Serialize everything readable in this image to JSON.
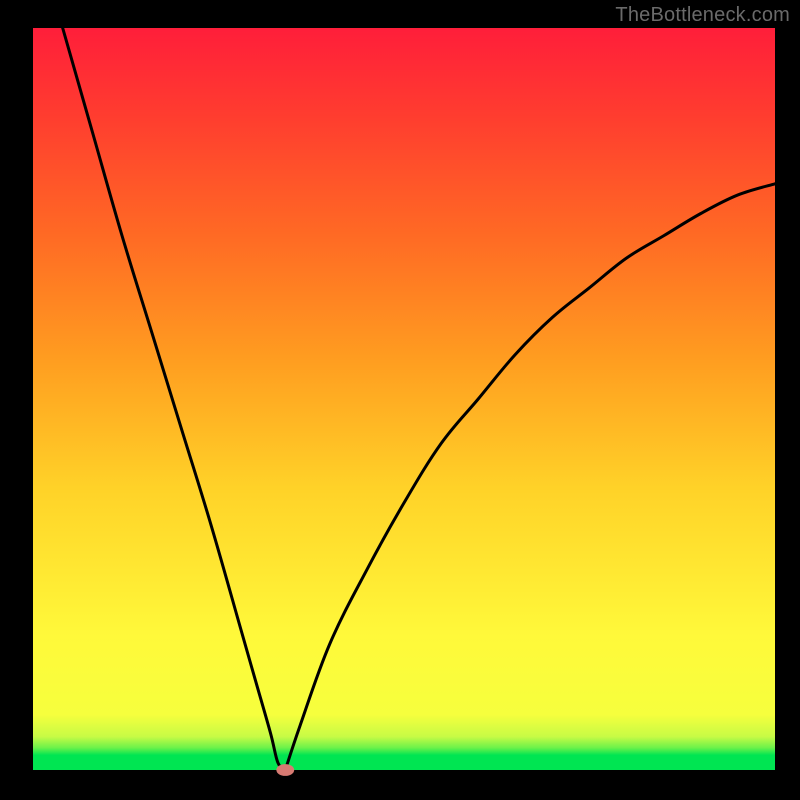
{
  "watermark": "TheBottleneck.com",
  "chart_data": {
    "type": "line",
    "title": "",
    "xlabel": "",
    "ylabel": "",
    "xlim": [
      0,
      100
    ],
    "ylim": [
      0,
      100
    ],
    "axes_visible": false,
    "grid": false,
    "gradient_bands": [
      {
        "name": "green",
        "color": "#00e552",
        "y_from": 0,
        "y_to": 4
      },
      {
        "name": "yellow",
        "color": "#f6ff3d",
        "y_from": 4,
        "y_to": 45
      },
      {
        "name": "orange",
        "color": "#ff8a1f",
        "y_from": 45,
        "y_to": 75
      },
      {
        "name": "red",
        "color": "#ff1e3a",
        "y_from": 75,
        "y_to": 100
      }
    ],
    "series": [
      {
        "name": "bottleneck-curve",
        "type": "line",
        "color": "#000000",
        "x": [
          4,
          8,
          12,
          16,
          20,
          24,
          28,
          30,
          32,
          33,
          34,
          36,
          40,
          45,
          50,
          55,
          60,
          65,
          70,
          75,
          80,
          85,
          90,
          95,
          100
        ],
        "values": [
          100,
          86,
          72,
          59,
          46,
          33,
          19,
          12,
          5,
          1,
          0,
          6,
          17,
          27,
          36,
          44,
          50,
          56,
          61,
          65,
          69,
          72,
          75,
          77.5,
          79
        ]
      }
    ],
    "marker": {
      "name": "sweet-spot",
      "shape": "ellipse",
      "color": "#d77a72",
      "x": 34,
      "y": 0,
      "rx": 1.2,
      "ry": 0.8
    }
  }
}
